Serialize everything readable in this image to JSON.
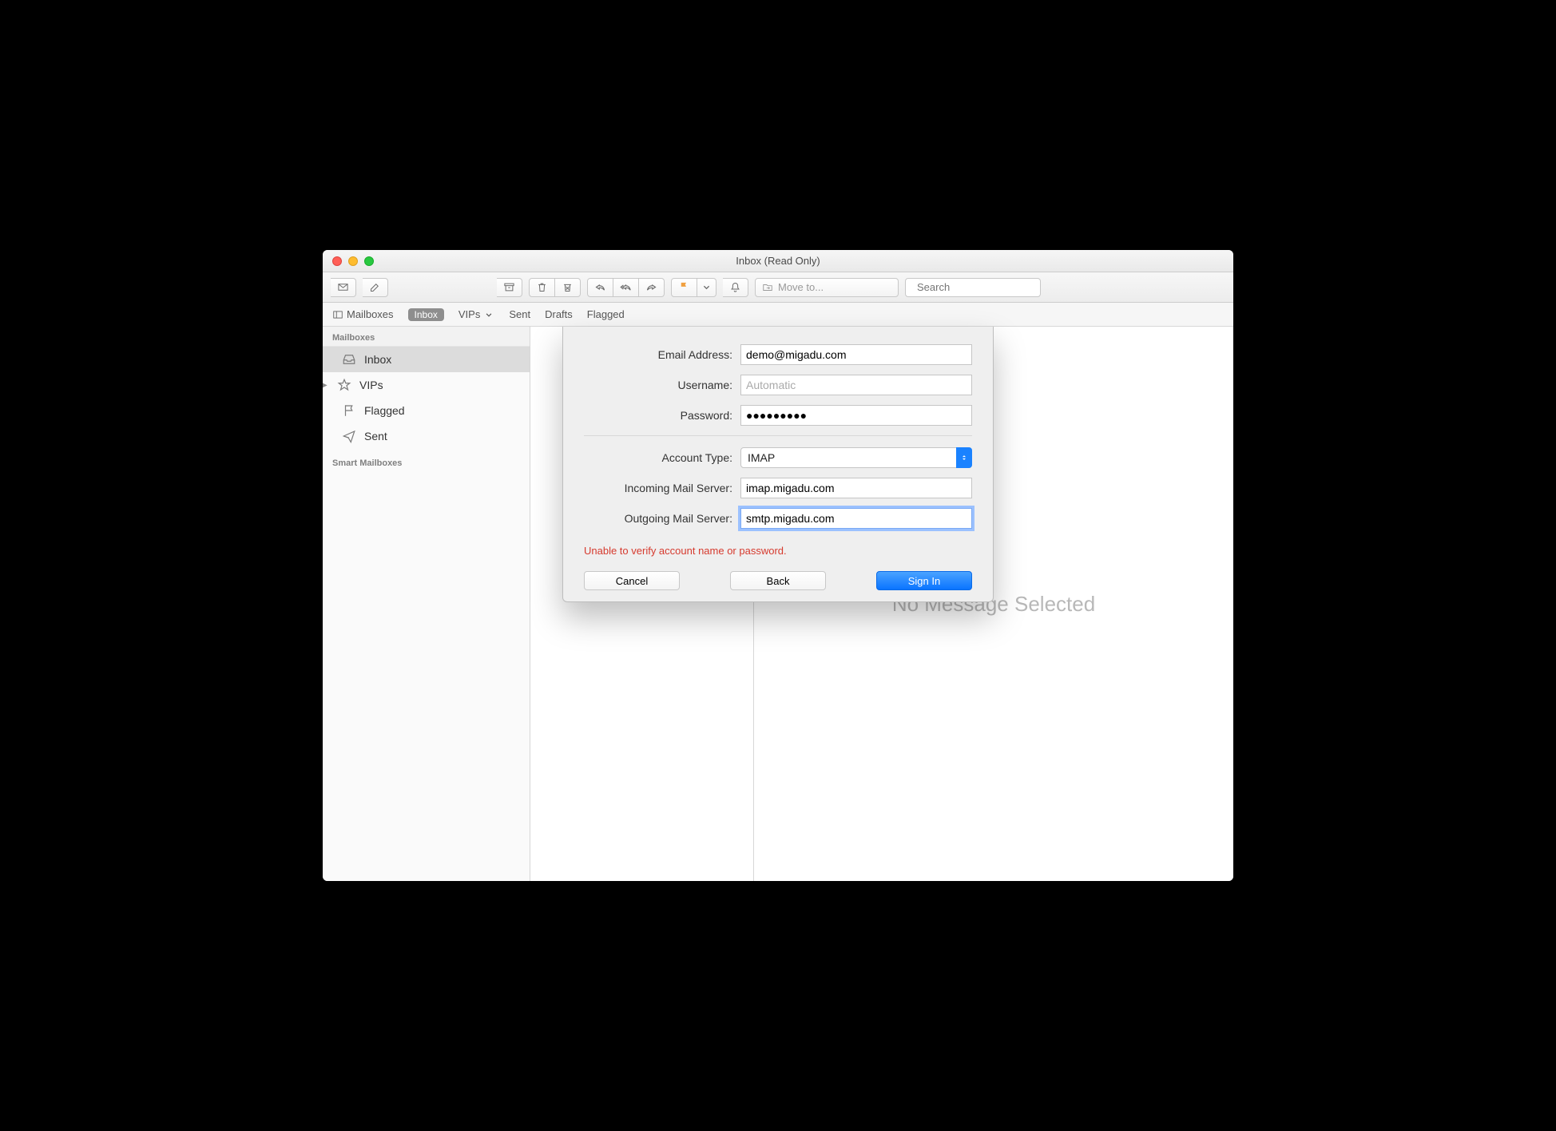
{
  "window": {
    "title": "Inbox (Read Only)"
  },
  "toolbar": {
    "move_placeholder": "Move to...",
    "search_placeholder": "Search"
  },
  "favbar": {
    "mailboxes": "Mailboxes",
    "inbox": "Inbox",
    "vips": "VIPs",
    "sent": "Sent",
    "drafts": "Drafts",
    "flagged": "Flagged"
  },
  "sidebar": {
    "section_mailboxes": "Mailboxes",
    "inbox": "Inbox",
    "vips": "VIPs",
    "flagged": "Flagged",
    "sent": "Sent",
    "section_smart": "Smart Mailboxes"
  },
  "viewer": {
    "empty": "No Message Selected"
  },
  "dialog": {
    "labels": {
      "email": "Email Address:",
      "username": "Username:",
      "password": "Password:",
      "account_type": "Account Type:",
      "incoming": "Incoming Mail Server:",
      "outgoing": "Outgoing Mail Server:"
    },
    "values": {
      "email": "demo@migadu.com",
      "username": "",
      "username_placeholder": "Automatic",
      "password": "●●●●●●●●●",
      "account_type": "IMAP",
      "incoming": "imap.migadu.com",
      "outgoing": "smtp.migadu.com"
    },
    "error": "Unable to verify account name or password.",
    "buttons": {
      "cancel": "Cancel",
      "back": "Back",
      "signin": "Sign In"
    }
  }
}
